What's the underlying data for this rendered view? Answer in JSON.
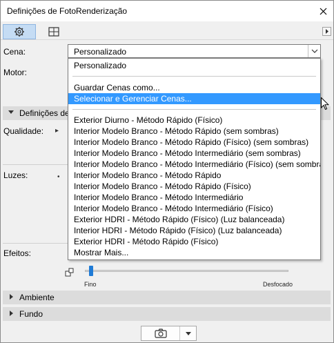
{
  "window": {
    "title": "Definições de FotoRenderização"
  },
  "toolbar": {
    "tabs": [
      {
        "icon": "gear-icon",
        "active": true
      },
      {
        "icon": "view-grid-icon",
        "active": false
      }
    ]
  },
  "scene": {
    "label": "Cena:",
    "value": "Personalizado"
  },
  "engine": {
    "label": "Motor:"
  },
  "dropdown": {
    "items_top": [
      "Personalizado"
    ],
    "items_manage": [
      "Guardar Cenas como...",
      "Selecionar e Gerenciar Cenas..."
    ],
    "highlighted": "Selecionar e Gerenciar Cenas...",
    "items_presets": [
      "Exterior Diurno - Método Rápido (Físico)",
      "Interior Modelo Branco - Método Rápido (sem sombras)",
      "Interior Modelo Branco - Método Rápido (Físico) (sem sombras)",
      "Interior Modelo Branco - Método Intermediário (sem sombras)",
      "Interior Modelo Branco - Método Intermediário (Físico) (sem sombras)",
      "Interior Modelo Branco - Método Rápido",
      "Interior Modelo Branco - Método Rápido (Físico)",
      "Interior Modelo Branco - Método Intermediário",
      "Interior Modelo Branco - Método Intermediário (Físico)",
      "Exterior HDRI - Método Rápido (Físico) (Luz balanceada)",
      "Interior HDRI - Método Rápido (Físico) (Luz balanceada)",
      "Exterior HDRI - Método Rápido (Físico)"
    ],
    "more": "Mostrar Mais..."
  },
  "sections": {
    "detailed": "Definições de",
    "quality_label": "Qualidade:",
    "lights_label": "Luzes:",
    "effects_label": "Efeitos:",
    "ambient": "Ambiente",
    "background": "Fundo"
  },
  "slider": {
    "min_label": "Fino",
    "max_label": "Desfocado",
    "level": 0.02
  },
  "colors": {
    "highlight": "#3399ff",
    "tab_active": "#c5dcf4",
    "slider_thumb": "#1f7bd6"
  }
}
